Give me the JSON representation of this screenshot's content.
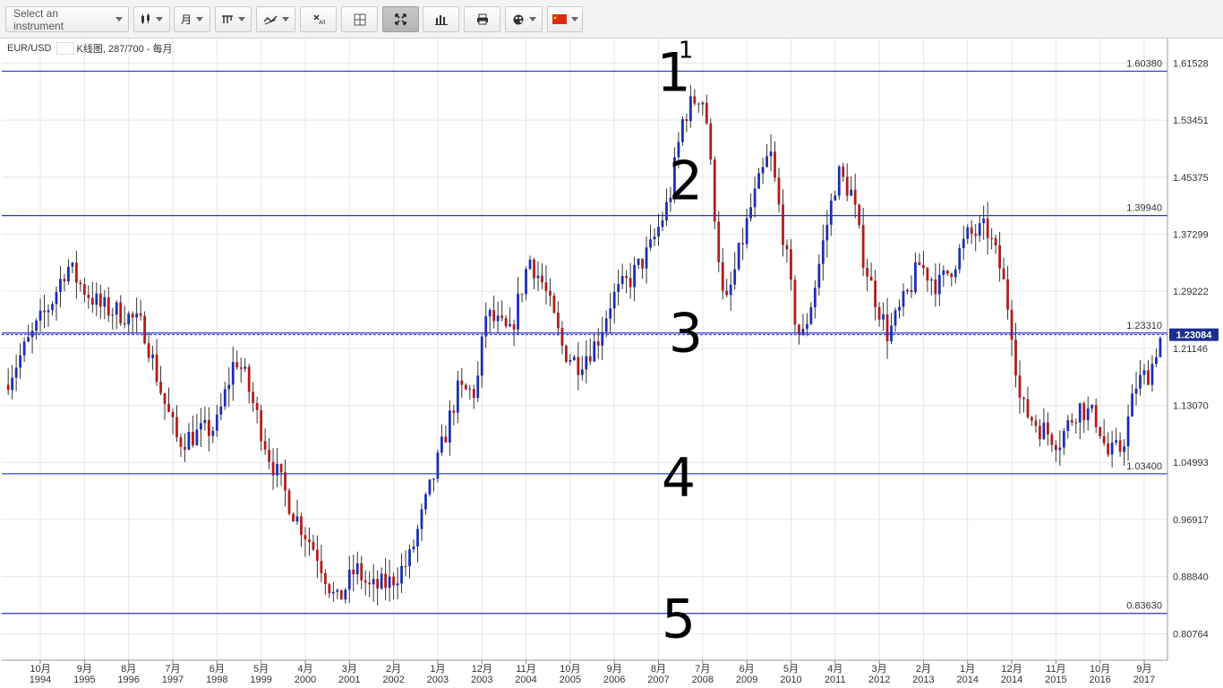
{
  "toolbar": {
    "instrument_placeholder": "Select an instrument",
    "period_label": "月",
    "buttons": [
      {
        "name": "chart-type-button",
        "icon": "candlestick-icon",
        "dropdown": true
      },
      {
        "name": "period-button",
        "icon": "period",
        "dropdown": true
      },
      {
        "name": "indicators-button",
        "icon": "indicators-icon",
        "dropdown": true
      },
      {
        "name": "drawing-tools-button",
        "icon": "drawing-tools-icon",
        "dropdown": true
      },
      {
        "name": "remove-all-button",
        "icon": "remove-all-icon",
        "dropdown": false
      },
      {
        "name": "crosshair-button",
        "icon": "crosshair-icon",
        "dropdown": false
      },
      {
        "name": "fullscreen-button",
        "icon": "fullscreen-icon",
        "dropdown": false,
        "active": true
      },
      {
        "name": "volume-button",
        "icon": "volume-bars-icon",
        "dropdown": false
      },
      {
        "name": "print-button",
        "icon": "print-icon",
        "dropdown": false
      },
      {
        "name": "color-theme-button",
        "icon": "palette-icon",
        "dropdown": true
      },
      {
        "name": "language-button",
        "icon": "china-flag-icon",
        "dropdown": true
      }
    ]
  },
  "legend": {
    "symbol": "EUR/USD",
    "description": "K线图, 287/700 - 每月"
  },
  "chart_data": {
    "type": "candlestick",
    "symbol": "EUR/USD",
    "interval": "monthly",
    "ylim": [
      0.77,
      1.65
    ],
    "y_ticks": [
      "1.61528",
      "1.53451",
      "1.45375",
      "1.37299",
      "1.29222",
      "1.21146",
      "1.13070",
      "1.04993",
      "0.96917",
      "0.88840",
      "0.80764"
    ],
    "x_ticks": [
      {
        "month": "10月",
        "year": "1994"
      },
      {
        "month": "9月",
        "year": "1995"
      },
      {
        "month": "8月",
        "year": "1996"
      },
      {
        "month": "7月",
        "year": "1997"
      },
      {
        "month": "6月",
        "year": "1998"
      },
      {
        "month": "5月",
        "year": "1999"
      },
      {
        "month": "4月",
        "year": "2000"
      },
      {
        "month": "3月",
        "year": "2001"
      },
      {
        "month": "2月",
        "year": "2002"
      },
      {
        "month": "1月",
        "year": "2003"
      },
      {
        "month": "12月",
        "year": "2003"
      },
      {
        "month": "11月",
        "year": "2004"
      },
      {
        "month": "10月",
        "year": "2005"
      },
      {
        "month": "9月",
        "year": "2006"
      },
      {
        "month": "8月",
        "year": "2007"
      },
      {
        "month": "7月",
        "year": "2008"
      },
      {
        "month": "6月",
        "year": "2009"
      },
      {
        "month": "5月",
        "year": "2010"
      },
      {
        "month": "4月",
        "year": "2011"
      },
      {
        "month": "3月",
        "year": "2012"
      },
      {
        "month": "2月",
        "year": "2013"
      },
      {
        "month": "1月",
        "year": "2014"
      },
      {
        "month": "12月",
        "year": "2014"
      },
      {
        "month": "11月",
        "year": "2015"
      },
      {
        "month": "10月",
        "year": "2016"
      },
      {
        "month": "9月",
        "year": "2017"
      }
    ],
    "horizontal_lines": [
      {
        "value": 1.6038,
        "label": "1.60380"
      },
      {
        "value": 1.3994,
        "label": "1.39940"
      },
      {
        "value": 1.2331,
        "label": "1.23310"
      },
      {
        "value": 1.034,
        "label": "1.03400"
      },
      {
        "value": 0.8363,
        "label": "0.83630"
      }
    ],
    "annotations": [
      {
        "text": "1",
        "value": 1.604,
        "year": 2007.9
      },
      {
        "text": "1",
        "value": 1.62,
        "year": 2008.15
      },
      {
        "text": "2",
        "value": 1.45,
        "year": 2008.15
      },
      {
        "text": "3",
        "value": 1.235,
        "year": 2008.15
      },
      {
        "text": "4",
        "value": 1.03,
        "year": 2008.0
      },
      {
        "text": "5",
        "value": 0.83,
        "year": 2008.0
      }
    ],
    "current_price": {
      "value": 1.23084,
      "label": "1.23084"
    },
    "path_anchors": [
      [
        1994.0,
        1.16
      ],
      [
        1994.5,
        1.22
      ],
      [
        1995.0,
        1.28
      ],
      [
        1995.3,
        1.33
      ],
      [
        1995.6,
        1.3
      ],
      [
        1996.0,
        1.27
      ],
      [
        1996.5,
        1.26
      ],
      [
        1996.9,
        1.24
      ],
      [
        1997.3,
        1.14
      ],
      [
        1997.6,
        1.08
      ],
      [
        1998.0,
        1.09
      ],
      [
        1998.4,
        1.1
      ],
      [
        1998.8,
        1.2
      ],
      [
        1999.0,
        1.17
      ],
      [
        1999.5,
        1.06
      ],
      [
        2000.0,
        0.98
      ],
      [
        2000.5,
        0.92
      ],
      [
        2000.9,
        0.85
      ],
      [
        2001.3,
        0.9
      ],
      [
        2001.6,
        0.87
      ],
      [
        2002.0,
        0.88
      ],
      [
        2002.4,
        0.91
      ],
      [
        2002.7,
        0.98
      ],
      [
        2003.0,
        1.05
      ],
      [
        2003.4,
        1.15
      ],
      [
        2003.8,
        1.15
      ],
      [
        2004.0,
        1.26
      ],
      [
        2004.5,
        1.23
      ],
      [
        2004.9,
        1.34
      ],
      [
        2005.2,
        1.3
      ],
      [
        2005.6,
        1.21
      ],
      [
        2005.9,
        1.19
      ],
      [
        2006.3,
        1.22
      ],
      [
        2006.6,
        1.28
      ],
      [
        2007.0,
        1.31
      ],
      [
        2007.4,
        1.35
      ],
      [
        2007.8,
        1.42
      ],
      [
        2008.1,
        1.54
      ],
      [
        2008.4,
        1.57
      ],
      [
        2008.55,
        1.56
      ],
      [
        2008.7,
        1.44
      ],
      [
        2008.95,
        1.26
      ],
      [
        2009.2,
        1.33
      ],
      [
        2009.5,
        1.41
      ],
      [
        2009.9,
        1.49
      ],
      [
        2010.2,
        1.36
      ],
      [
        2010.4,
        1.26
      ],
      [
        2010.55,
        1.22
      ],
      [
        2010.8,
        1.29
      ],
      [
        2011.0,
        1.36
      ],
      [
        2011.3,
        1.46
      ],
      [
        2011.6,
        1.43
      ],
      [
        2011.8,
        1.35
      ],
      [
        2012.0,
        1.3
      ],
      [
        2012.35,
        1.23
      ],
      [
        2012.7,
        1.28
      ],
      [
        2013.0,
        1.33
      ],
      [
        2013.4,
        1.3
      ],
      [
        2013.7,
        1.33
      ],
      [
        2014.0,
        1.37
      ],
      [
        2014.4,
        1.38
      ],
      [
        2014.7,
        1.32
      ],
      [
        2014.9,
        1.25
      ],
      [
        2015.1,
        1.13
      ],
      [
        2015.5,
        1.1
      ],
      [
        2015.9,
        1.08
      ],
      [
        2016.3,
        1.13
      ],
      [
        2016.7,
        1.11
      ],
      [
        2016.9,
        1.06
      ],
      [
        2017.2,
        1.07
      ],
      [
        2017.5,
        1.16
      ],
      [
        2017.8,
        1.18
      ],
      [
        2017.95,
        1.22
      ],
      [
        2018.05,
        1.23
      ]
    ]
  },
  "colors": {
    "bull": "#1a2fb8",
    "bear": "#b51a1a",
    "level_line": "#2b32c4",
    "grid": "#e6e6e6",
    "price_tag": "#1c2f8f"
  }
}
